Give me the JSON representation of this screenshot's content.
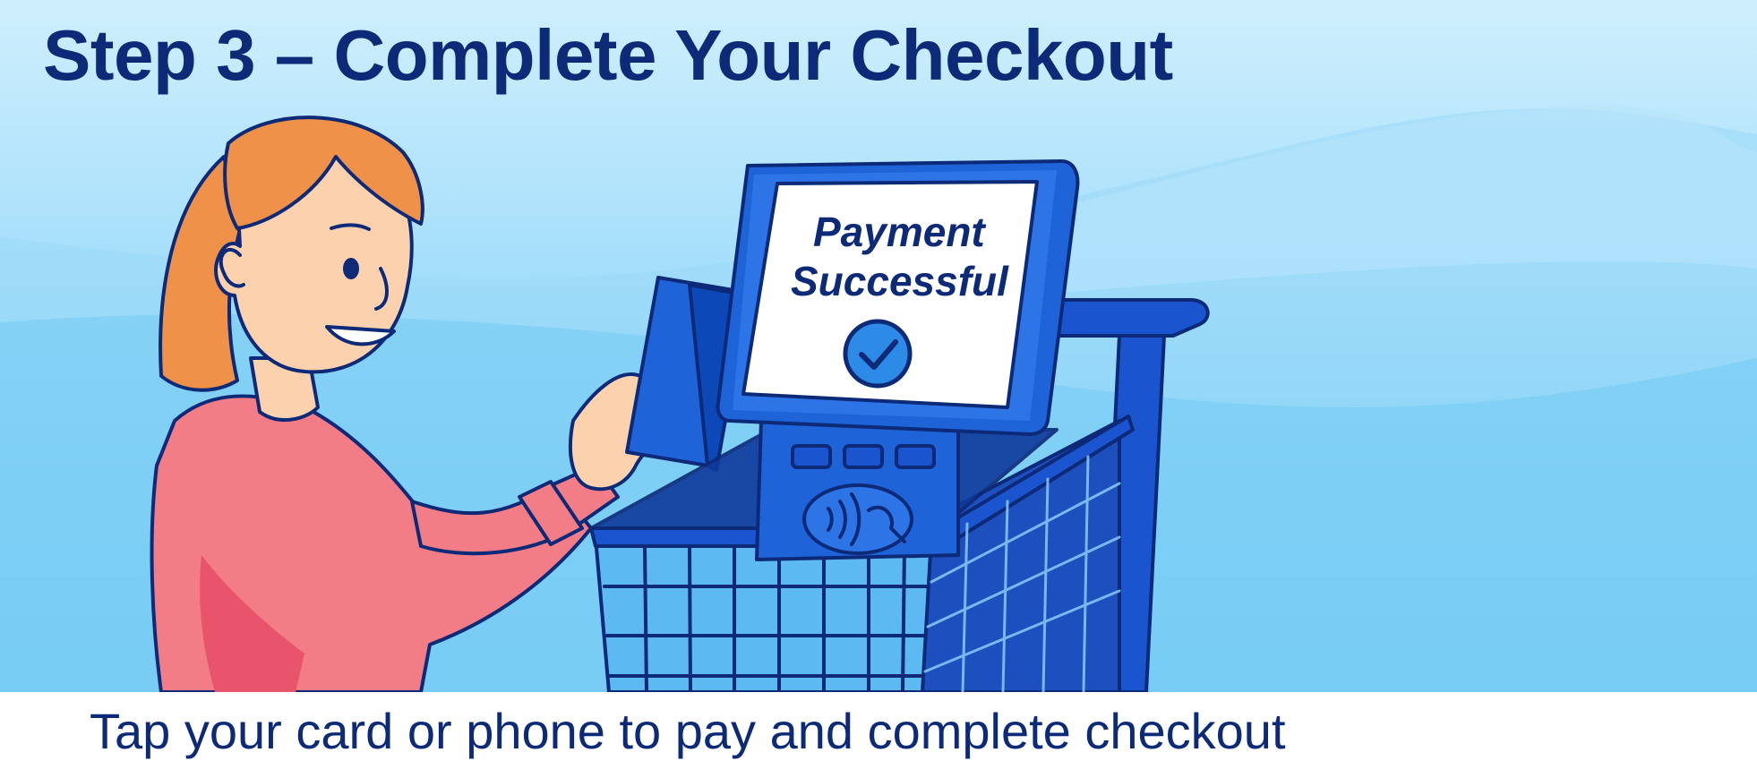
{
  "header": {
    "title": "Step 3 – Complete Your Checkout"
  },
  "kiosk": {
    "status_line1": "Payment",
    "status_line2": "Successful",
    "status_icon": "checkmark-circle-icon",
    "reader_icon": "contactless-payment-icon"
  },
  "caption": {
    "text": "Tap your card or phone to pay and complete checkout"
  },
  "colors": {
    "title_text": "#0d2a78",
    "outline": "#0d2a78",
    "kiosk_blue": "#1f63d8",
    "cart_blue": "#1a55cf",
    "sweater": "#f27d86",
    "hair": "#f0914a",
    "skin": "#fcd2ae",
    "sky_top": "#cfeffd",
    "sky_bottom": "#5ec4f4"
  }
}
